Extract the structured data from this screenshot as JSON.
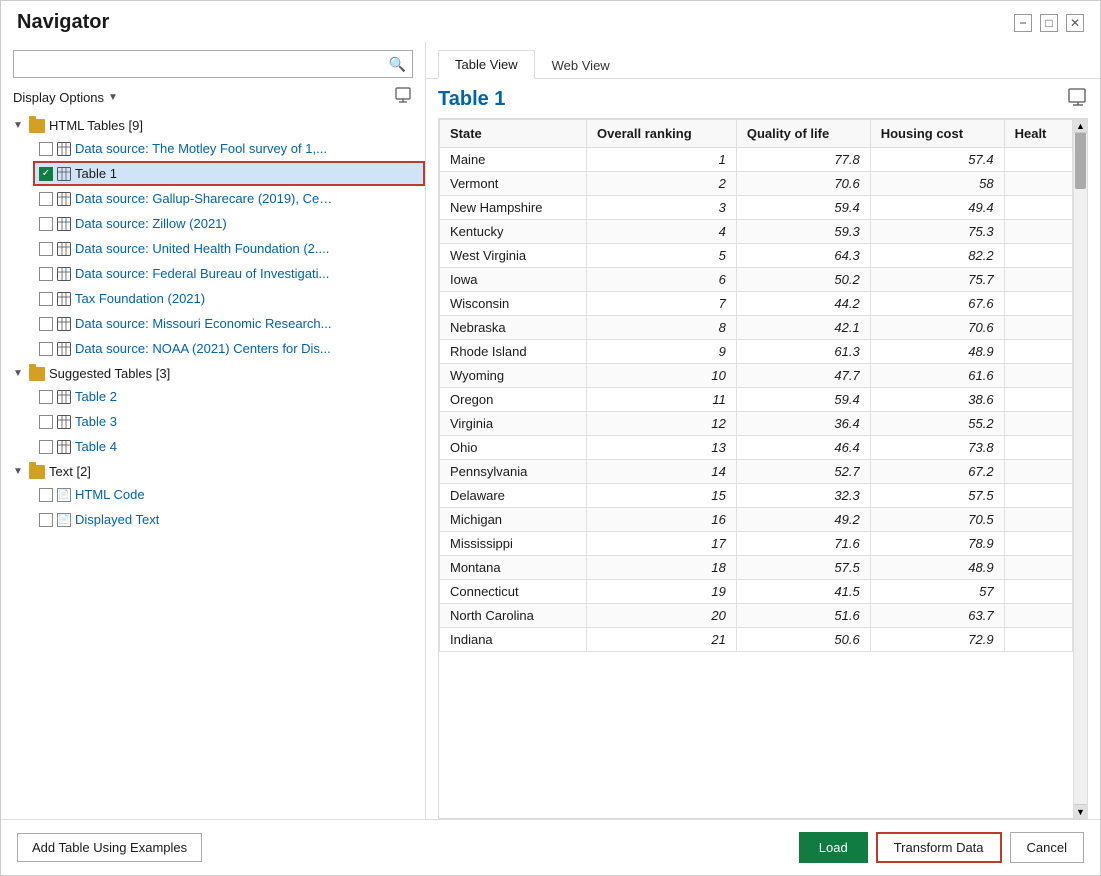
{
  "window": {
    "title": "Navigator"
  },
  "left_panel": {
    "search_placeholder": "",
    "display_options_label": "Display Options",
    "groups": [
      {
        "id": "html-tables",
        "label": "HTML Tables [9]",
        "expanded": true,
        "items": [
          {
            "id": "ds-motley",
            "label": "Data source: The Motley Fool survey of 1,...",
            "checked": false,
            "selected": false
          },
          {
            "id": "table1",
            "label": "Table 1",
            "checked": true,
            "selected": true
          },
          {
            "id": "ds-gallup",
            "label": "Data source: Gallup-Sharecare (2019), Cen...",
            "checked": false,
            "selected": false
          },
          {
            "id": "ds-zillow",
            "label": "Data source: Zillow (2021)",
            "checked": false,
            "selected": false
          },
          {
            "id": "ds-uhf",
            "label": "Data source: United Health Foundation (2....",
            "checked": false,
            "selected": false
          },
          {
            "id": "ds-fbi",
            "label": "Data source: Federal Bureau of Investigati...",
            "checked": false,
            "selected": false
          },
          {
            "id": "tax",
            "label": "Tax Foundation (2021)",
            "checked": false,
            "selected": false
          },
          {
            "id": "ds-mo",
            "label": "Data source: Missouri Economic Research...",
            "checked": false,
            "selected": false
          },
          {
            "id": "ds-noaa",
            "label": "Data source: NOAA (2021) Centers for Dis...",
            "checked": false,
            "selected": false
          }
        ]
      },
      {
        "id": "suggested-tables",
        "label": "Suggested Tables [3]",
        "expanded": true,
        "items": [
          {
            "id": "table2",
            "label": "Table 2",
            "checked": false,
            "selected": false
          },
          {
            "id": "table3",
            "label": "Table 3",
            "checked": false,
            "selected": false
          },
          {
            "id": "table4",
            "label": "Table 4",
            "checked": false,
            "selected": false
          }
        ]
      },
      {
        "id": "text",
        "label": "Text [2]",
        "expanded": true,
        "items": [
          {
            "id": "html-code",
            "label": "HTML Code",
            "checked": false,
            "selected": false,
            "type": "text"
          },
          {
            "id": "displayed-text",
            "label": "Displayed Text",
            "checked": false,
            "selected": false,
            "type": "text"
          }
        ]
      }
    ]
  },
  "right_panel": {
    "tabs": [
      {
        "id": "table-view",
        "label": "Table View",
        "active": true
      },
      {
        "id": "web-view",
        "label": "Web View",
        "active": false
      }
    ],
    "preview_title": "Table 1",
    "columns": [
      "State",
      "Overall ranking",
      "Quality of life",
      "Housing cost",
      "Health"
    ],
    "rows": [
      {
        "State": "Maine",
        "Overall ranking": "1",
        "Quality of life": "77.8",
        "Housing cost": "57.4",
        "Health": ""
      },
      {
        "State": "Vermont",
        "Overall ranking": "2",
        "Quality of life": "70.6",
        "Housing cost": "58",
        "Health": ""
      },
      {
        "State": "New Hampshire",
        "Overall ranking": "3",
        "Quality of life": "59.4",
        "Housing cost": "49.4",
        "Health": ""
      },
      {
        "State": "Kentucky",
        "Overall ranking": "4",
        "Quality of life": "59.3",
        "Housing cost": "75.3",
        "Health": ""
      },
      {
        "State": "West Virginia",
        "Overall ranking": "5",
        "Quality of life": "64.3",
        "Housing cost": "82.2",
        "Health": ""
      },
      {
        "State": "Iowa",
        "Overall ranking": "6",
        "Quality of life": "50.2",
        "Housing cost": "75.7",
        "Health": ""
      },
      {
        "State": "Wisconsin",
        "Overall ranking": "7",
        "Quality of life": "44.2",
        "Housing cost": "67.6",
        "Health": ""
      },
      {
        "State": "Nebraska",
        "Overall ranking": "8",
        "Quality of life": "42.1",
        "Housing cost": "70.6",
        "Health": ""
      },
      {
        "State": "Rhode Island",
        "Overall ranking": "9",
        "Quality of life": "61.3",
        "Housing cost": "48.9",
        "Health": ""
      },
      {
        "State": "Wyoming",
        "Overall ranking": "10",
        "Quality of life": "47.7",
        "Housing cost": "61.6",
        "Health": ""
      },
      {
        "State": "Oregon",
        "Overall ranking": "11",
        "Quality of life": "59.4",
        "Housing cost": "38.6",
        "Health": ""
      },
      {
        "State": "Virginia",
        "Overall ranking": "12",
        "Quality of life": "36.4",
        "Housing cost": "55.2",
        "Health": ""
      },
      {
        "State": "Ohio",
        "Overall ranking": "13",
        "Quality of life": "46.4",
        "Housing cost": "73.8",
        "Health": ""
      },
      {
        "State": "Pennsylvania",
        "Overall ranking": "14",
        "Quality of life": "52.7",
        "Housing cost": "67.2",
        "Health": ""
      },
      {
        "State": "Delaware",
        "Overall ranking": "15",
        "Quality of life": "32.3",
        "Housing cost": "57.5",
        "Health": ""
      },
      {
        "State": "Michigan",
        "Overall ranking": "16",
        "Quality of life": "49.2",
        "Housing cost": "70.5",
        "Health": ""
      },
      {
        "State": "Mississippi",
        "Overall ranking": "17",
        "Quality of life": "71.6",
        "Housing cost": "78.9",
        "Health": ""
      },
      {
        "State": "Montana",
        "Overall ranking": "18",
        "Quality of life": "57.5",
        "Housing cost": "48.9",
        "Health": ""
      },
      {
        "State": "Connecticut",
        "Overall ranking": "19",
        "Quality of life": "41.5",
        "Housing cost": "57",
        "Health": ""
      },
      {
        "State": "North Carolina",
        "Overall ranking": "20",
        "Quality of life": "51.6",
        "Housing cost": "63.7",
        "Health": ""
      },
      {
        "State": "Indiana",
        "Overall ranking": "21",
        "Quality of life": "50.6",
        "Housing cost": "72.9",
        "Health": ""
      }
    ]
  },
  "bottom_bar": {
    "add_table_label": "Add Table Using Examples",
    "load_label": "Load",
    "transform_label": "Transform Data",
    "cancel_label": "Cancel"
  }
}
